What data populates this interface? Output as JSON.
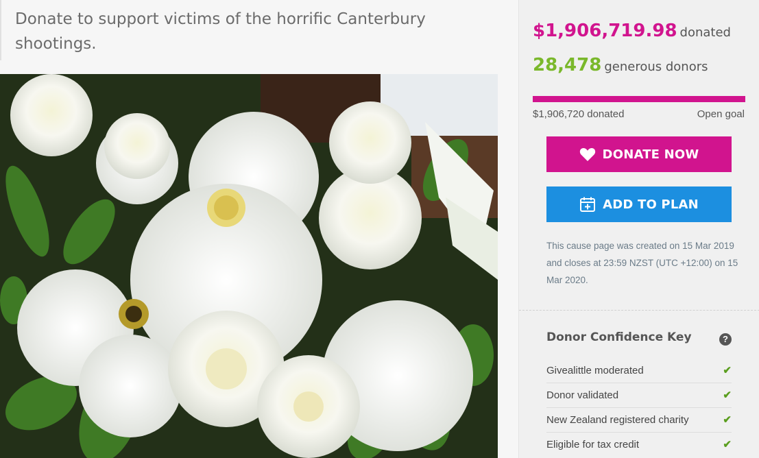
{
  "headline": "Donate to support victims of the horrific Canterbury shootings.",
  "photo": {
    "icon": "white-flowers-photo"
  },
  "stats": {
    "amount": "$1,906,719.98",
    "amount_suffix": "donated",
    "donors": "28,478",
    "donors_suffix": "generous donors"
  },
  "progress": {
    "fill_fraction": 1.0,
    "left_label": "$1,906,720 donated",
    "right_label": "Open goal"
  },
  "buttons": {
    "donate": "DONATE NOW",
    "plan": "ADD TO PLAN"
  },
  "info": "This cause page was created on 15 Mar 2019 and closes at 23:59 NZST (UTC +12:00) on 15 Mar 2020.",
  "confidence": {
    "title": "Donor Confidence Key",
    "help": "?",
    "items": [
      {
        "label": "Givealittle moderated",
        "check": "✔"
      },
      {
        "label": "Donor validated",
        "check": "✔"
      },
      {
        "label": "New Zealand registered charity",
        "check": "✔"
      },
      {
        "label": "Eligible for tax credit",
        "check": "✔"
      }
    ]
  },
  "colors": {
    "brand_pink": "#d1148e",
    "donor_green": "#7ab82b",
    "plan_blue": "#1c8fe0",
    "check_green": "#5a9e1e"
  }
}
